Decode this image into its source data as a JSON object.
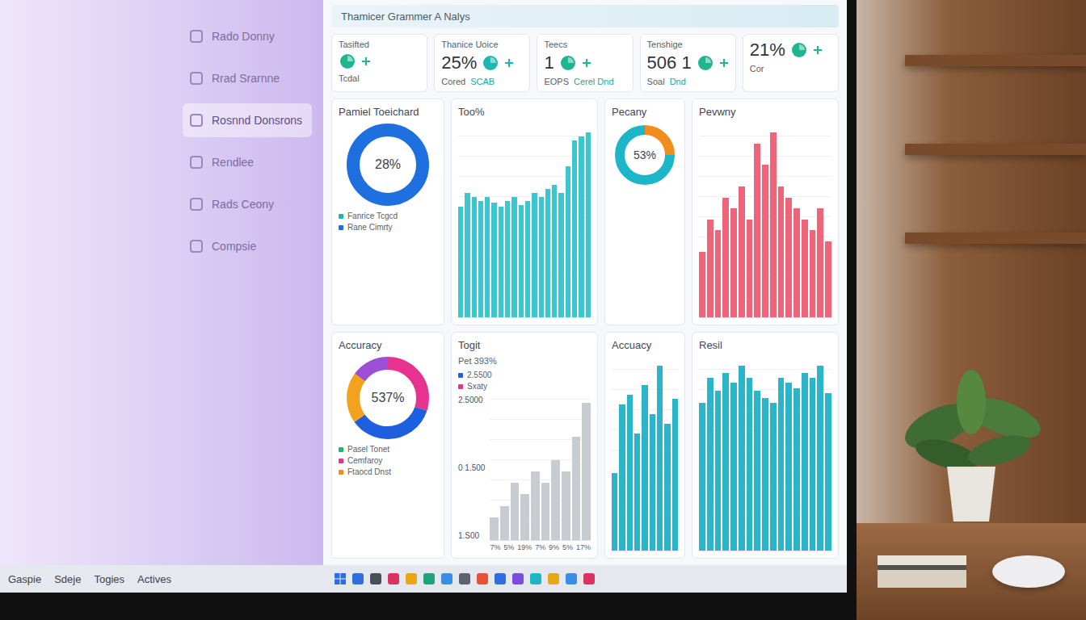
{
  "window": {
    "title": "Thamicer Grammer A Nalys"
  },
  "sidebar": {
    "items": [
      {
        "label": "Rado Donny",
        "selected": false
      },
      {
        "label": "Rrad Srarnne",
        "selected": false
      },
      {
        "label": "Rosnnd Donsrons",
        "selected": true
      },
      {
        "label": "Rendlee",
        "selected": false
      },
      {
        "label": "Rads Ceony",
        "selected": false
      },
      {
        "label": "Compsie",
        "selected": false
      }
    ]
  },
  "stats": [
    {
      "title": "Tasifted",
      "label": "Tcdal",
      "color": "#1fb58f"
    },
    {
      "title": "Thanice Uoice",
      "value": "25%",
      "label": "Cored",
      "sub": "SCAB",
      "color": "#1bb7b0"
    },
    {
      "title": "Teecs",
      "value": "1",
      "label": "EOPS",
      "sub": "Cerel Dnd",
      "color": "#1fb58f"
    },
    {
      "title": "Tenshige",
      "value": "506 1",
      "label": "Soal",
      "sub": "Dnd",
      "color": "#1fb58f"
    },
    {
      "value": "21%",
      "label": "Cor",
      "color": "#1fb58f"
    }
  ],
  "panels": [
    {
      "kind": "donut",
      "title": "Pamiel Toeichard",
      "center": "28%",
      "segments": [
        {
          "value": 100,
          "color": "#1e6fe0"
        }
      ],
      "legend": [
        {
          "label": "Fanrice Tcgcd",
          "color": "#1bb7b0"
        },
        {
          "label": "Rane Cimrty",
          "color": "#1e6fe0"
        }
      ]
    },
    {
      "kind": "bars",
      "title": "Too%",
      "color": "#3cc6cf",
      "values": [
        55,
        62,
        60,
        58,
        60,
        57,
        55,
        58,
        60,
        56,
        58,
        62,
        60,
        64,
        66,
        62,
        75,
        88,
        90,
        92
      ]
    },
    {
      "kind": "donut",
      "title": "Pecany",
      "center": "53%",
      "segments": [
        {
          "value": 25,
          "color": "#f28c1c"
        },
        {
          "value": 75,
          "color": "#1bb7c8"
        }
      ]
    },
    {
      "kind": "bars",
      "title": "Pevwny",
      "color": "#f0647a",
      "values": [
        30,
        45,
        40,
        55,
        50,
        60,
        45,
        80,
        70,
        85,
        60,
        55,
        50,
        45,
        40,
        50,
        35
      ]
    },
    {
      "kind": "donut",
      "title": "Accuracy",
      "center": "537%",
      "segments": [
        {
          "value": 30,
          "color": "#e6338f"
        },
        {
          "value": 35,
          "color": "#1e5fe0"
        },
        {
          "value": 20,
          "color": "#f2a21c"
        },
        {
          "value": 15,
          "color": "#9a4fd6"
        }
      ],
      "legend": [
        {
          "label": "Pasel Tonet",
          "color": "#1bb77a"
        },
        {
          "label": "Cemfaroy",
          "color": "#e6338f"
        },
        {
          "label": "Ftaocd Dnst",
          "color": "#f28c1c"
        }
      ]
    },
    {
      "kind": "togit",
      "title": "Togit",
      "subtitle": "Pet 393%",
      "color": "#c8ccd2",
      "values": [
        10,
        15,
        25,
        20,
        30,
        25,
        35,
        30,
        45,
        60
      ],
      "legend": [
        {
          "label": "2.5500",
          "color": "#1e5fe0"
        },
        {
          "label": "Sxaty",
          "color": "#e6338f"
        }
      ],
      "ticks": [
        "2.5000",
        "0 1.500",
        "1.S00"
      ],
      "xlabels": [
        "7%",
        "5%",
        "19%",
        "7%",
        "9%",
        "5%",
        "17%"
      ]
    },
    {
      "kind": "bars",
      "title": "Accuacy",
      "color": "#2ab5c8",
      "values": [
        40,
        75,
        80,
        60,
        85,
        70,
        95,
        65,
        78
      ]
    },
    {
      "kind": "bars",
      "title": "Resil",
      "color": "#2ab5c8",
      "values": [
        60,
        70,
        65,
        72,
        68,
        75,
        70,
        65,
        62,
        60,
        70,
        68,
        66,
        72,
        70,
        75,
        64
      ]
    }
  ],
  "taskbar": {
    "items": [
      "Gaspie",
      "Sdeje",
      "Togies",
      "Actives"
    ],
    "icons": [
      {
        "color": "#2f6fdc"
      },
      {
        "color": "#4a4f5c"
      },
      {
        "color": "#d8345f"
      },
      {
        "color": "#e6a817"
      },
      {
        "color": "#1fa37a"
      },
      {
        "color": "#3a8ee6"
      },
      {
        "color": "#5b6270"
      },
      {
        "color": "#e2533a"
      },
      {
        "color": "#2f6fdc"
      },
      {
        "color": "#7c4ddb"
      },
      {
        "color": "#1fb5c4"
      },
      {
        "color": "#e6a817"
      },
      {
        "color": "#3a8ee6"
      },
      {
        "color": "#d8345f"
      }
    ]
  }
}
